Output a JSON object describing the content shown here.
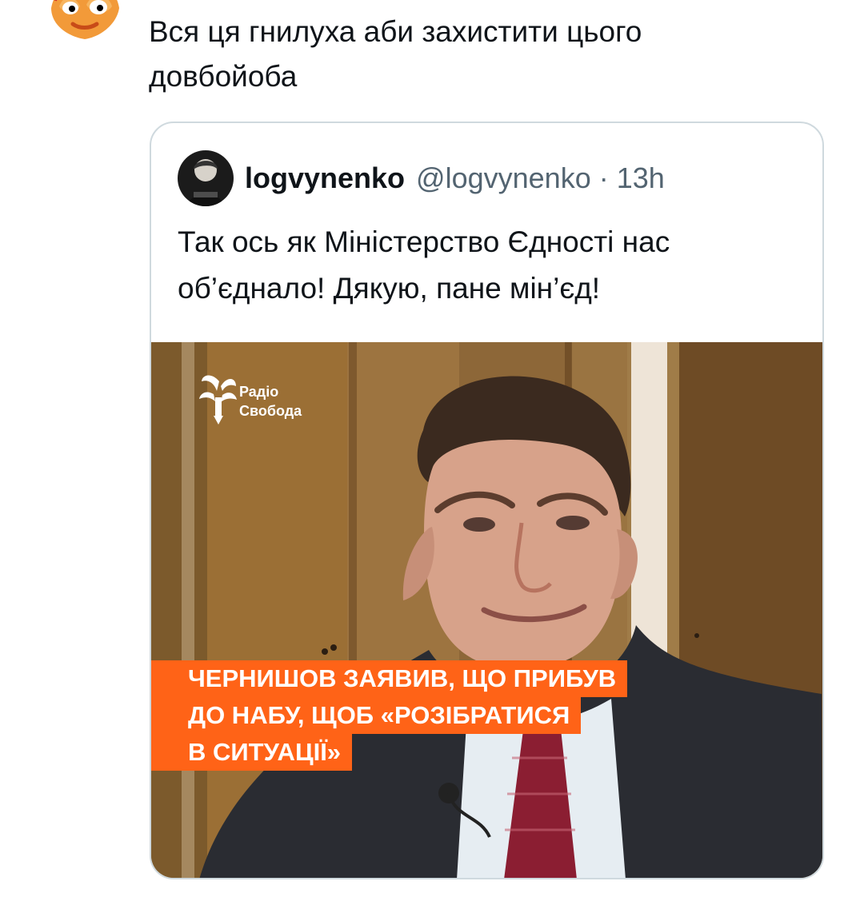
{
  "tweet": {
    "text_line1": "Вся ця гнилуха аби захистити цього",
    "text_line2": "довбойоба"
  },
  "quoted_tweet": {
    "author_name": "logvynenko",
    "author_handle": "@logvynenko",
    "separator": "·",
    "time": "13h",
    "text_line1": "Так ось як Міністерство Єдності нас",
    "text_line2": "об’єднало! Дякую, пане мін’єд!",
    "media": {
      "logo_line1": "Радіо",
      "logo_line2": "Свобода",
      "caption_line1": "ЧЕРНИШОВ ЗАЯВИВ, ЩО ПРИБУВ",
      "caption_line2": "ДО НАБУ, ЩОБ «РОЗІБРАТИСЯ",
      "caption_line3": "В СИТУАЦІЇ»",
      "accent_color": "#ff6317"
    }
  },
  "icons": {
    "user_avatar": "cartoon-face-avatar-icon",
    "quote_avatar": "logvynenko-avatar-icon",
    "logo": "radio-svoboda-logo-icon"
  }
}
